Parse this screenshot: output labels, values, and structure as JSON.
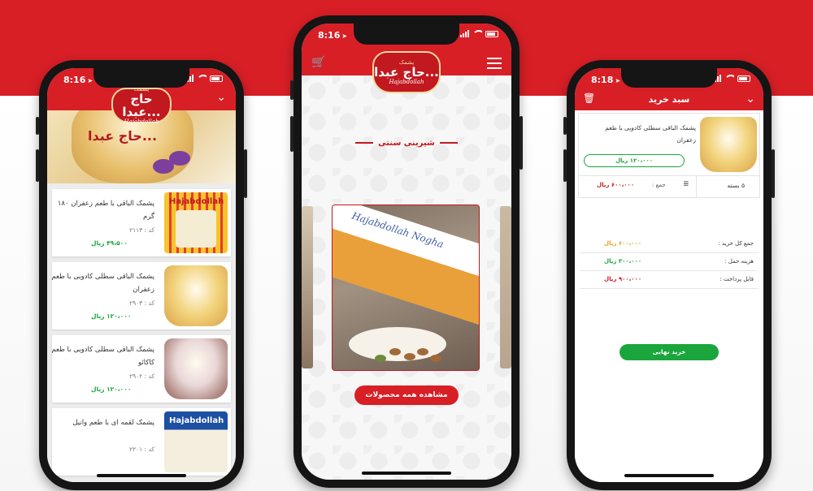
{
  "colors": {
    "brand_red": "#d81f26",
    "price_green": "#18a53b",
    "accent_orange": "#e6a023",
    "checkout_green": "#1aa63c"
  },
  "status": {
    "phone1_time": "8:16",
    "phone2_time": "8:16",
    "phone3_time": "8:18",
    "location_icon": "location-arrow-icon"
  },
  "logo": {
    "line1": "پشمک",
    "line2": "حاج عبدا...",
    "line3": "Hajabdollah"
  },
  "list_screen": {
    "hero_brand": "حاج عبدا...",
    "hero_brand_latin": "Hajabdollah",
    "products": [
      {
        "name": "پشمک الباقی با طعم زعفران ۱۸۰ گرم",
        "code": "کد : ۲۱۱۳",
        "price": "۴۹،۵۰۰ ریال",
        "thumb_label": "Hajabdollah"
      },
      {
        "name": "پشمک الباقی سطلی کادویی با طعم زعفران",
        "code": "کد : ۲۹۰۳",
        "price": "۱۲۰،۰۰۰ ریال",
        "thumb_label": ""
      },
      {
        "name": "پشمک الباقی سطلی کادویی با طعم کاکائو",
        "code": "کد : ۲۹۰۲",
        "price": "۱۲۰،۰۰۰ ریال",
        "thumb_label": ""
      },
      {
        "name": "پشمک لقمه ای با طعم وانیل",
        "code": "کد : ۲۲۰۱",
        "price": "",
        "thumb_label": "Hajabdollah"
      }
    ]
  },
  "home_screen": {
    "section_title": "شیرینی سنتی",
    "slide_box_text": "Hajabdollah Nogha",
    "view_all_button": "مشاهده همه محصولات"
  },
  "cart_screen": {
    "title": "سبد خرید",
    "item": {
      "name": "پشمک الباقی سطلی کادویی با طعم زعفران",
      "unit_price": "۱۲۰،۰۰۰ ریال",
      "quantity": "۵ بسته",
      "sum_label": "جمع :",
      "sum_value": "۶۰۰،۰۰۰ ریال"
    },
    "summary": [
      {
        "label": "جمع کل خرید :",
        "value": "۶۰۰،۰۰۰ ریال",
        "color": "#e6a023"
      },
      {
        "label": "هزینه حمل :",
        "value": "۳۰۰،۰۰۰ ریال",
        "color": "#18a53b"
      },
      {
        "label": "قابل پرداخت :",
        "value": "۹۰۰،۰۰۰ ریال",
        "color": "#c2181f"
      }
    ],
    "checkout_button": "خرید نهایی"
  }
}
